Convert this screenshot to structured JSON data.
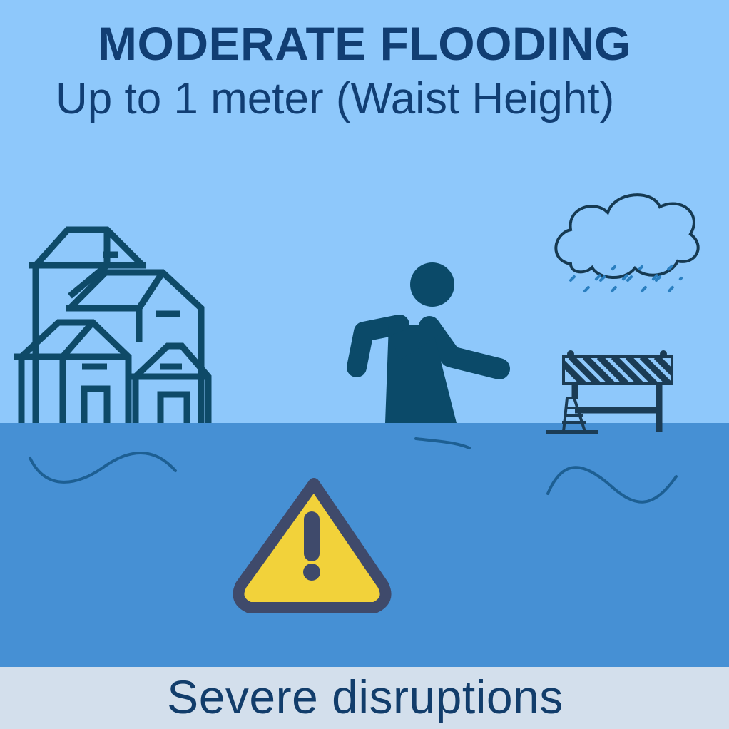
{
  "header": {
    "title": "MODERATE FLOODING",
    "subtitle": "Up to 1 meter (Waist Height)"
  },
  "footer": {
    "label": "Severe disruptions"
  },
  "icons": [
    "houses-icon",
    "walking-person-icon",
    "rain-cloud-icon",
    "road-barrier-icon",
    "traffic-cone-icon",
    "warning-icon"
  ],
  "colors": {
    "sky": "#8ec8fb",
    "water": "#4690d4",
    "footer_bg": "#d3dfec",
    "text": "#113e73",
    "icon_dark": "#0d4a6b",
    "warning_fill": "#f2d23a",
    "warning_stroke": "#3f4a6b"
  }
}
